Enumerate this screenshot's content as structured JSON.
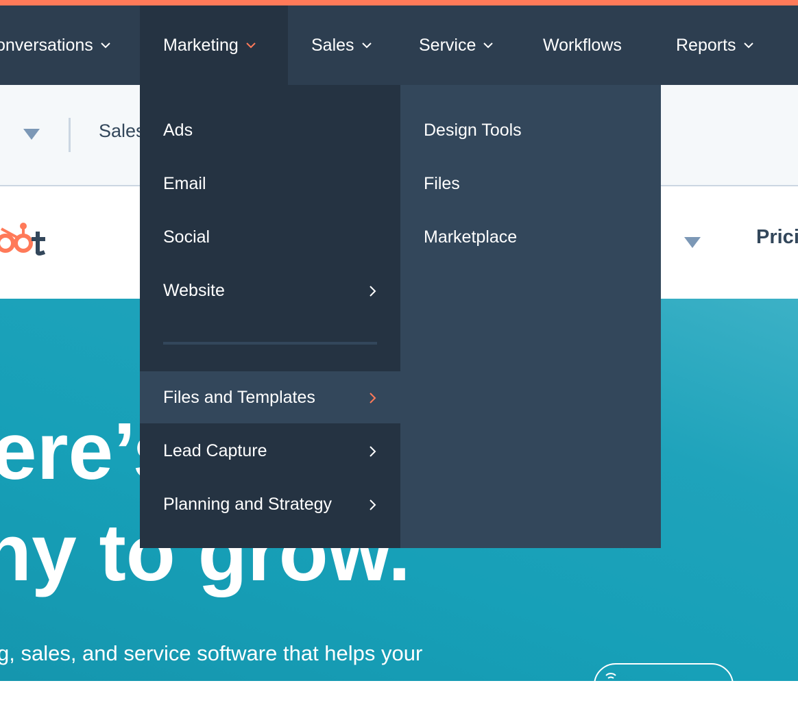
{
  "nav": {
    "items": [
      {
        "label": "onversations",
        "has_chevron": true
      },
      {
        "label": "Marketing",
        "has_chevron": true,
        "active": true
      },
      {
        "label": "Sales",
        "has_chevron": true
      },
      {
        "label": "Service",
        "has_chevron": true
      },
      {
        "label": "Workflows",
        "has_chevron": false
      },
      {
        "label": "Reports",
        "has_chevron": true
      }
    ]
  },
  "subbar": {
    "text": "Sales"
  },
  "header": {
    "pricing": "Prici"
  },
  "marketing_menu": {
    "primary": [
      {
        "label": "Ads"
      },
      {
        "label": "Email"
      },
      {
        "label": "Social"
      },
      {
        "label": "Website",
        "has_submenu": true
      },
      {
        "label": "Files and Templates",
        "has_submenu": true,
        "highlighted": true
      },
      {
        "label": "Lead Capture",
        "has_submenu": true
      },
      {
        "label": "Planning and Strategy",
        "has_submenu": true
      }
    ],
    "secondary": [
      {
        "label": "Design Tools"
      },
      {
        "label": "Files"
      },
      {
        "label": "Marketplace"
      }
    ]
  },
  "hero": {
    "line1": "ere’s",
    "line2": "ny to grow.",
    "subtext": "g, sales, and service software that helps your"
  },
  "colors": {
    "accent": "#ff7a59",
    "nav_bg": "#2d3e50",
    "menu_dark": "#253342",
    "menu_light": "#33475b",
    "hero": "#1ea2ba"
  },
  "icons": {
    "chevron": "chevron-down-icon",
    "submenu_arrow": "chevron-right-icon",
    "logo": "hubspot-sprocket-icon"
  }
}
